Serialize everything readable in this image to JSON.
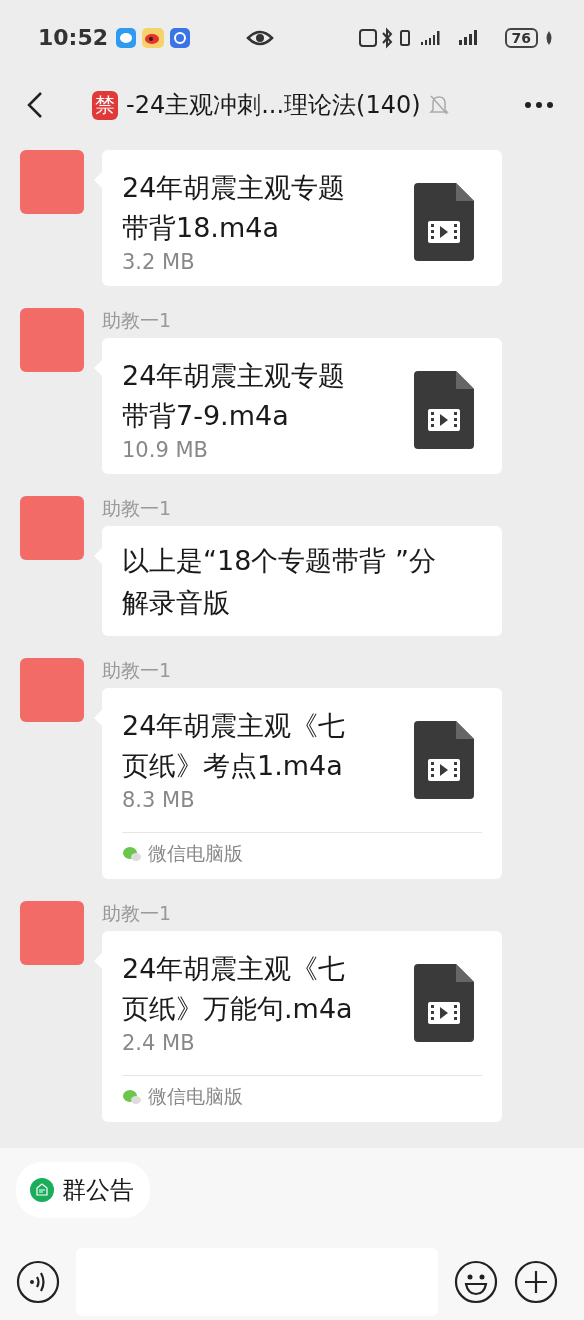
{
  "status_bar": {
    "time": "10:52",
    "battery": "76"
  },
  "header": {
    "badge": "禁",
    "title": "-24主观冲刺...理论法(140)",
    "muted": true
  },
  "messages": [
    {
      "kind": "file",
      "title": "24年胡震主观专题带背18.m4a",
      "size": "3.2 MB"
    },
    {
      "kind": "file",
      "sender": "助教一1",
      "title": "24年胡震主观专题带背7-9.m4a",
      "size": "10.9 MB"
    },
    {
      "kind": "text",
      "sender": "助教一1",
      "text": "以上是“18个专题带背 ”分解录音版"
    },
    {
      "kind": "file",
      "sender": "助教一1",
      "title": "24年胡震主观《七页纸》考点1.m4a",
      "size": "8.3 MB",
      "source": "微信电脑版"
    },
    {
      "kind": "file",
      "sender": "助教一1",
      "title": "24年胡震主观《七页纸》万能句.m4a",
      "size": "2.4 MB",
      "source": "微信电脑版"
    }
  ],
  "announcement": {
    "label": "群公告"
  }
}
